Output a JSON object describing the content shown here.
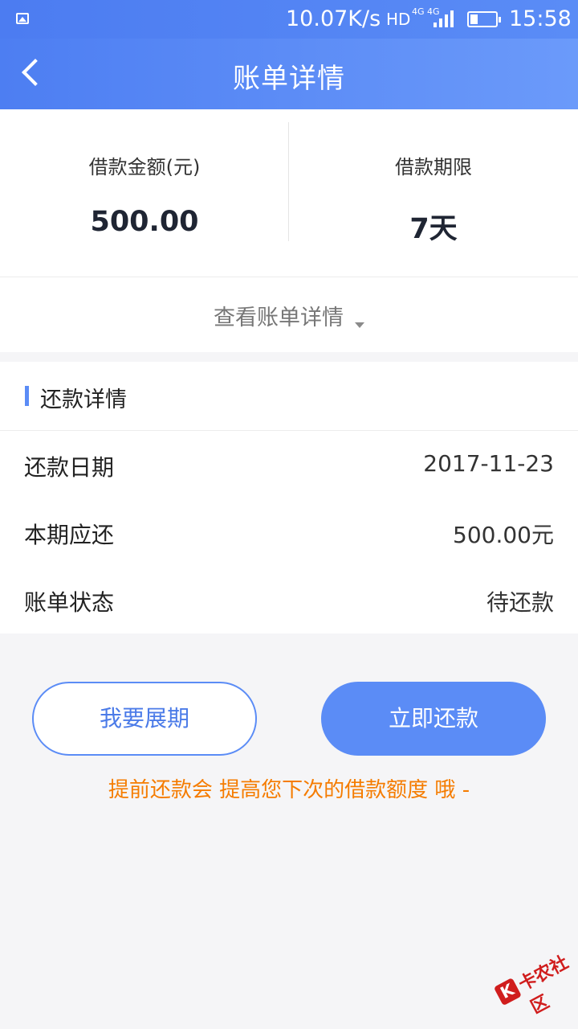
{
  "status_bar": {
    "speed": "10.07K/s",
    "hd": "HD",
    "network": "4G 4G",
    "time": "15:58",
    "icons": [
      "picture-icon",
      "signal-icon",
      "battery-icon"
    ]
  },
  "nav": {
    "title": "账单详情",
    "back_icon": "chevron-left-icon"
  },
  "summary": {
    "amount_label": "借款金额(元)",
    "amount_value": "500.00",
    "term_label": "借款期限",
    "term_value": "7天"
  },
  "toggle": {
    "label": "查看账单详情",
    "icon": "caret-down-icon"
  },
  "repay": {
    "section_title": "还款详情",
    "rows": [
      {
        "label": "还款日期",
        "value": "2017-11-23"
      },
      {
        "label": "本期应还",
        "value": "500.00元"
      },
      {
        "label": "账单状态",
        "value": "待还款"
      }
    ]
  },
  "actions": {
    "extend_label": "我要展期",
    "pay_label": "立即还款"
  },
  "tip": "提前还款会 提高您下次的借款额度 哦 -",
  "watermark": {
    "text": "卡农社区"
  },
  "colors": {
    "accent": "#5b8cf6",
    "tip": "#f57c00",
    "watermark": "#d01d1d"
  }
}
